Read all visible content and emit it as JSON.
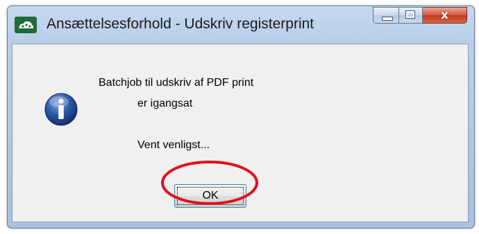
{
  "window": {
    "title": "Ansættelsesforhold - Udskriv registerprint",
    "app_icon": "cloud-logo-icon",
    "controls": {
      "minimize": "minimize-icon",
      "maximize": "maximize-icon",
      "close": "close-icon",
      "close_glyph": "x"
    }
  },
  "dialog": {
    "icon": "info-icon",
    "message_line1": "Batchjob til udskriv af PDF print",
    "message_line2": "er igangsat",
    "message_line3": "Vent venligst...",
    "ok_label": "OK"
  },
  "annotation": {
    "shape": "red-ellipse",
    "color": "#e0101c",
    "target": "ok-button"
  },
  "colors": {
    "titlebar": "#b9cfe9",
    "client": "#f0f0f0",
    "close_button": "#c13a1f",
    "info_icon": "#1c3f86"
  }
}
